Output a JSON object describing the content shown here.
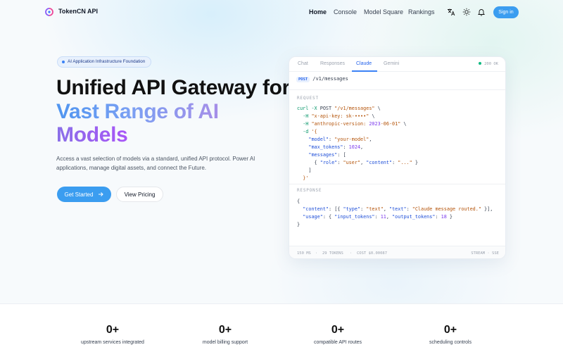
{
  "nav": {
    "brand": "TokenCN API",
    "links": [
      {
        "label": "Home",
        "active": true
      },
      {
        "label": "Console"
      },
      {
        "label": "Model Square"
      },
      {
        "label": "Rankings"
      }
    ],
    "icons": [
      "translate-icon",
      "sun-icon",
      "bell-icon"
    ],
    "signin_label": "Sign in"
  },
  "hero": {
    "badge": "AI Application Infrastructure Foundation",
    "title_line1": "Unified API Gateway for",
    "title_line2": "Vast Range of AI",
    "title_line3": "Models",
    "description": "Access a vast selection of models via a standard, unified API protocol. Power AI applications, manage digital assets, and connect the Future.",
    "primary_label": "Get Started",
    "secondary_label": "View Pricing"
  },
  "api_card": {
    "tabs": [
      {
        "label": "Chat"
      },
      {
        "label": "Responses"
      },
      {
        "label": "Claude",
        "active": true
      },
      {
        "label": "Gemini"
      }
    ],
    "status": "200 OK",
    "method": "POST",
    "path": "/v1/messages",
    "request_label": "REQUEST",
    "response_label": "RESPONSE",
    "request_lines": [
      "curl -X POST \"/v1/messages\" \\",
      "  -H \"x-api-key: sk-••••\" \\",
      "  -H \"anthropic-version: 2023-06-01\" \\",
      "  -d '{",
      "    \"model\": \"your-model\",",
      "    \"max_tokens\": 1024,",
      "    \"messages\": [",
      "      { \"role\": \"user\", \"content\": \"...\" }",
      "    ]",
      "  }'"
    ],
    "response_lines": [
      "{",
      "  \"content\": [{ \"type\": \"text\", \"text\": \"Claude message routed.\" }],",
      "  \"usage\": { \"input_tokens\": 11, \"output_tokens\": 18 }",
      "}"
    ],
    "footer": {
      "latency": "150 MS",
      "tokens": "29 TOKENS",
      "cost": "COST $0.00087",
      "mode": "STREAM · SSE"
    }
  },
  "stats": [
    {
      "value": "0+",
      "label": "upstream services integrated"
    },
    {
      "value": "0+",
      "label": "model billing support"
    },
    {
      "value": "0+",
      "label": "compatible API routes"
    },
    {
      "value": "0+",
      "label": "scheduling controls"
    }
  ],
  "colors": {
    "accent": "#3b9df0",
    "gradient_blue": "#4f95f0",
    "gradient_purple": "#a855f7",
    "status_ok": "#10b981"
  }
}
